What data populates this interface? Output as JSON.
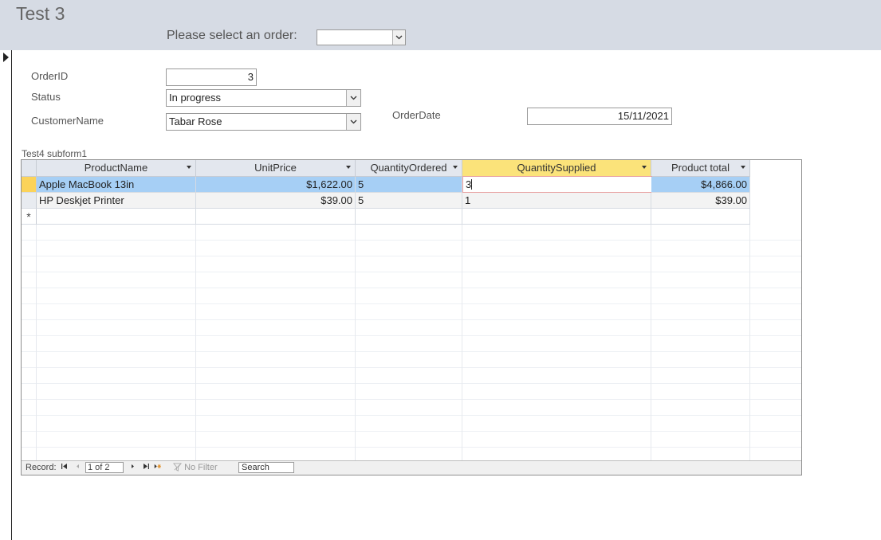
{
  "form": {
    "title": "Test 3",
    "select_order_label": "Please select an order:",
    "select_order_value": ""
  },
  "fields": {
    "order_id": {
      "label": "OrderID",
      "value": "3"
    },
    "status": {
      "label": "Status",
      "value": "In progress"
    },
    "customer_name": {
      "label": "CustomerName",
      "value": "Tabar Rose"
    },
    "order_date": {
      "label": "OrderDate",
      "value": "15/11/2021"
    }
  },
  "subform": {
    "label": "Test4 subform1",
    "columns": [
      "ProductName",
      "UnitPrice",
      "QuantityOrdered",
      "QuantitySupplied",
      "Product total"
    ],
    "active_column": "QuantitySupplied",
    "rows": [
      {
        "product_name": "Apple MacBook  13in",
        "unit_price": "$1,622.00",
        "quantity_ordered": "5",
        "quantity_supplied": "3",
        "product_total": "$4,866.00"
      },
      {
        "product_name": "HP Deskjet Printer",
        "unit_price": "$39.00",
        "quantity_ordered": "5",
        "quantity_supplied": "1",
        "product_total": "$39.00"
      }
    ],
    "new_row_marker": "*",
    "nav": {
      "record_label": "Record:",
      "position": "1 of 2",
      "filter_label": "No Filter",
      "search_placeholder": "Search"
    }
  },
  "colors": {
    "header_bg": "#d6dbe4",
    "selected_row": "#a6cff5",
    "active_column_header": "#fbe37a",
    "record_selector_selected": "#fbd35a"
  }
}
